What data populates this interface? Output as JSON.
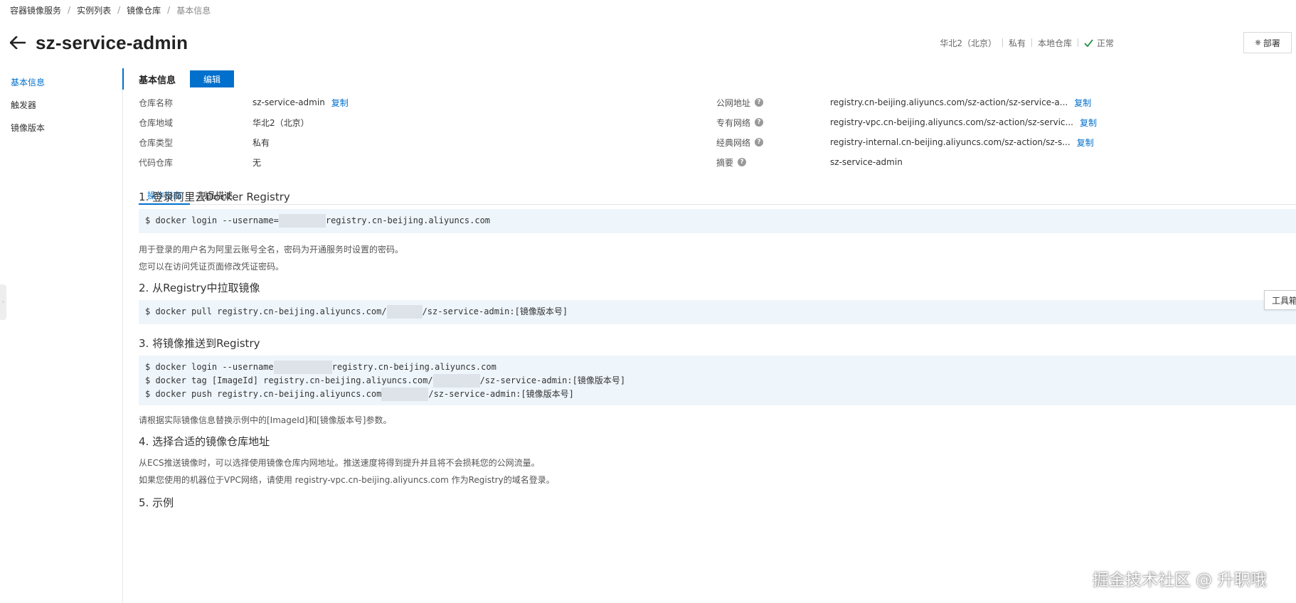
{
  "breadcrumb": [
    "容器镜像服务",
    "实例列表",
    "镜像仓库",
    "基本信息"
  ],
  "page_title": "sz-service-admin",
  "status": {
    "region": "华北2（北京）",
    "type": "私有",
    "source": "本地仓库",
    "state": "正常",
    "deploy_label": "部署"
  },
  "sidenav": [
    {
      "label": "基本信息",
      "active": true
    },
    {
      "label": "触发器",
      "active": false
    },
    {
      "label": "镜像版本",
      "active": false
    }
  ],
  "section": {
    "title": "基本信息",
    "edit_label": "编辑"
  },
  "copy_label": "复制",
  "info_left": [
    {
      "label": "仓库名称",
      "value": "sz-service-admin",
      "copy": true
    },
    {
      "label": "仓库地域",
      "value": "华北2（北京）",
      "copy": false
    },
    {
      "label": "仓库类型",
      "value": "私有",
      "copy": false
    },
    {
      "label": "代码仓库",
      "value": "无",
      "copy": false
    }
  ],
  "info_right": [
    {
      "label": "公网地址",
      "value": "registry.cn-beijing.aliyuncs.com/sz-action/sz-service-a...",
      "copy": true
    },
    {
      "label": "专有网络",
      "value": "registry-vpc.cn-beijing.aliyuncs.com/sz-action/sz-servic...",
      "copy": true
    },
    {
      "label": "经典网络",
      "value": "registry-internal.cn-beijing.aliyuncs.com/sz-action/sz-s...",
      "copy": true
    },
    {
      "label": "摘要",
      "value": "sz-service-admin",
      "copy": false
    }
  ],
  "tabs": [
    {
      "label": "操作指南",
      "active": true
    },
    {
      "label": "制品描述",
      "active": false
    }
  ],
  "guide": {
    "step1": {
      "title": "1. 登录阿里云Docker Registry",
      "code": {
        "pre": "$ docker login --username=",
        "post": "registry.cn-beijing.aliyuncs.com"
      },
      "notes": [
        "用于登录的用户名为阿里云账号全名，密码为开通服务时设置的密码。",
        "您可以在访问凭证页面修改凭证密码。"
      ]
    },
    "step2": {
      "title": "2. 从Registry中拉取镜像",
      "code": {
        "pre": "$ docker pull registry.cn-beijing.aliyuncs.com/",
        "post": "/sz-service-admin:[镜像版本号]"
      }
    },
    "step3": {
      "title": "3. 将镜像推送到Registry",
      "code": [
        {
          "pre": "$ docker login --username",
          "post": "registry.cn-beijing.aliyuncs.com"
        },
        {
          "pre": "$ docker tag [ImageId] registry.cn-beijing.aliyuncs.com/",
          "post": "/sz-service-admin:[镜像版本号]"
        },
        {
          "pre": "$ docker push registry.cn-beijing.aliyuncs.com",
          "post": "/sz-service-admin:[镜像版本号]"
        }
      ],
      "note": "请根据实际镜像信息替换示例中的[ImageId]和[镜像版本号]参数。"
    },
    "step4": {
      "title": "4. 选择合适的镜像仓库地址",
      "notes": [
        "从ECS推送镜像时，可以选择使用镜像仓库内网地址。推送速度将得到提升并且将不会损耗您的公网流量。",
        "如果您使用的机器位于VPC网络，请使用 registry-vpc.cn-beijing.aliyuncs.com 作为Registry的域名登录。"
      ]
    },
    "step5": {
      "title": "5. 示例"
    }
  },
  "toolbox_label": "工具箱",
  "watermark": "掘金技术社区 @ 升职哦"
}
